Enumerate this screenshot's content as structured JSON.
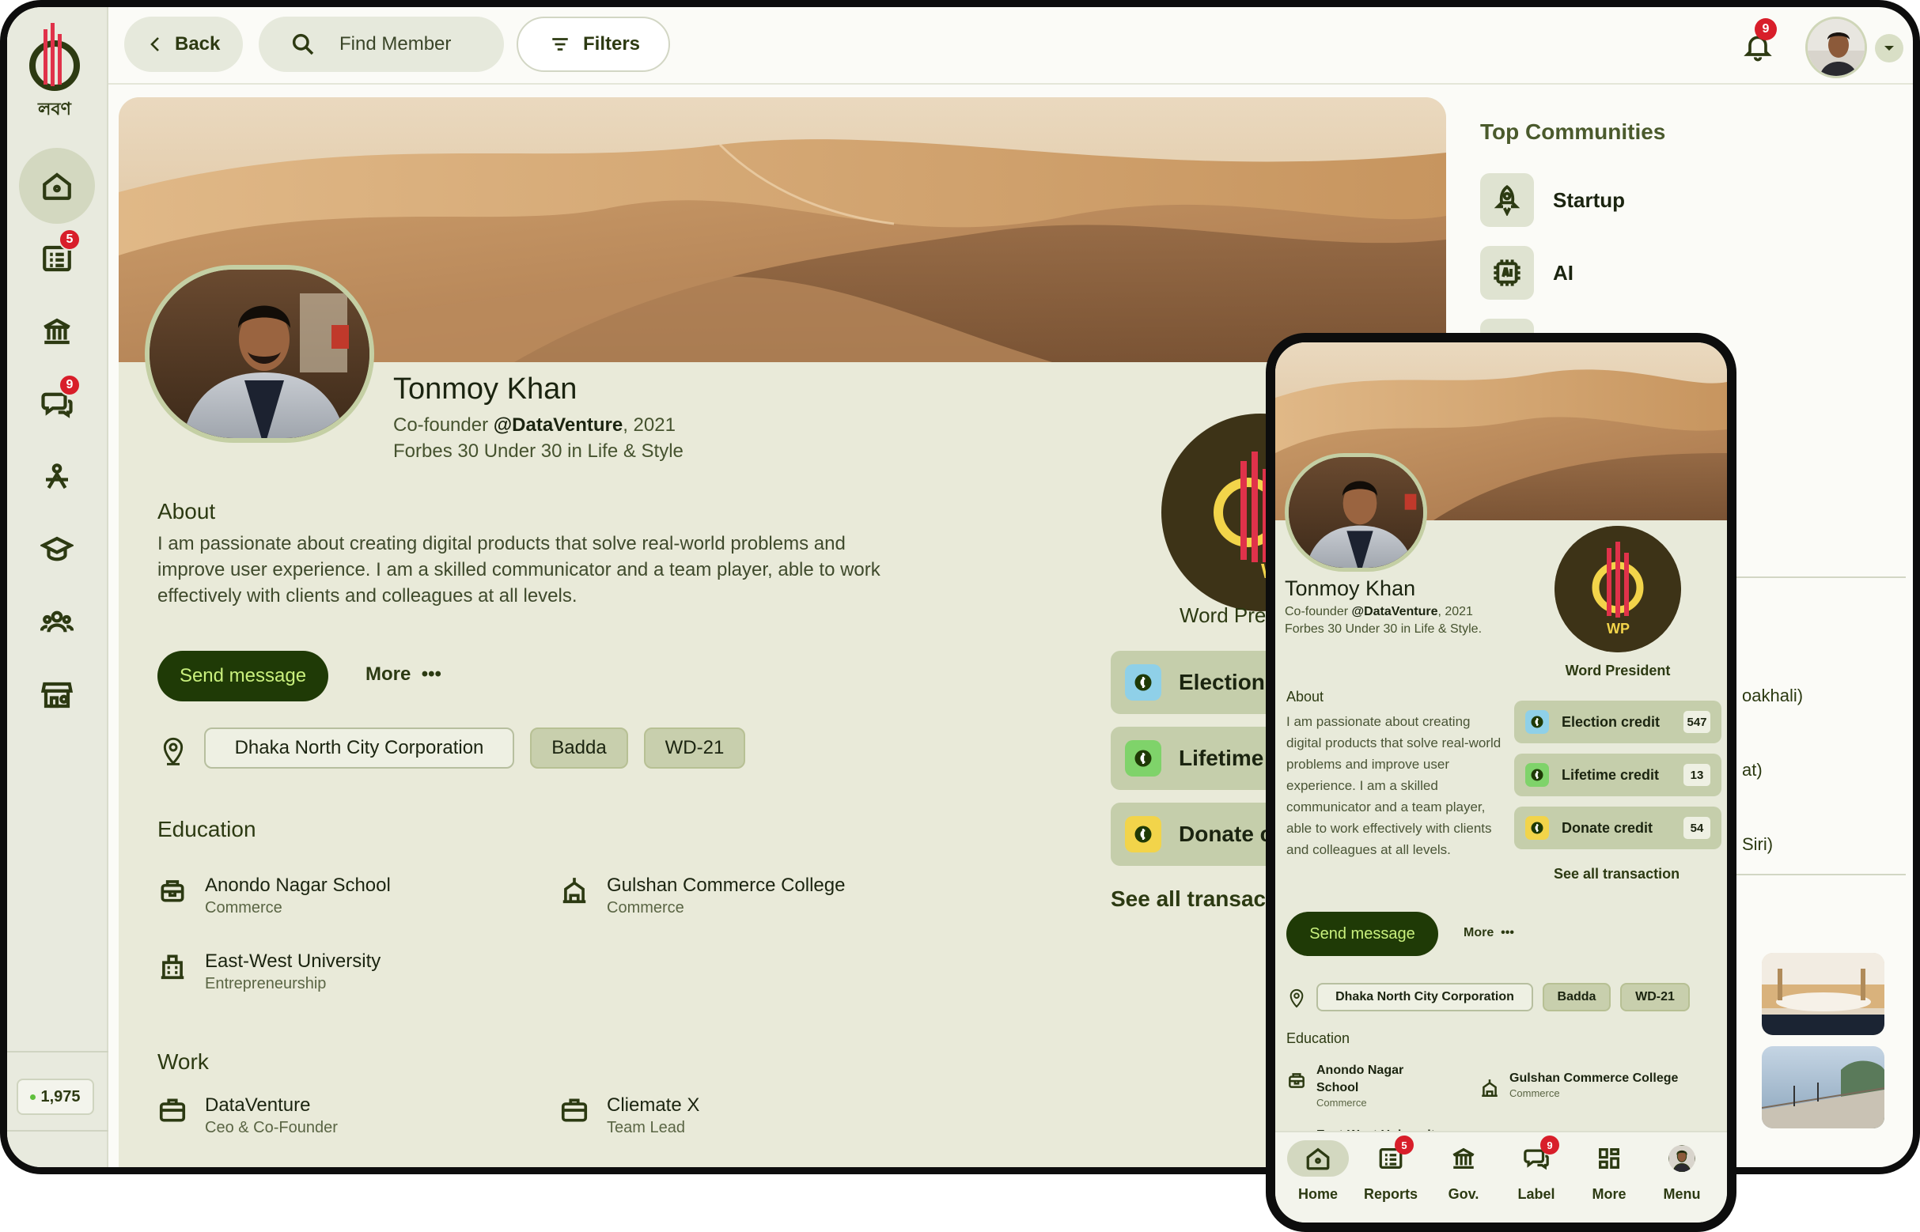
{
  "app": {
    "logo_text": "লবণ",
    "points": "1,975"
  },
  "sidebar": {
    "items": [
      {
        "icon": "home-icon"
      },
      {
        "icon": "reports-icon",
        "badge": "5"
      },
      {
        "icon": "government-icon"
      },
      {
        "icon": "chat-icon",
        "badge": "9"
      },
      {
        "icon": "community-icon"
      },
      {
        "icon": "education-icon"
      },
      {
        "icon": "people-icon"
      },
      {
        "icon": "store-icon"
      }
    ]
  },
  "topbar": {
    "back_label": "Back",
    "find_label": "Find Member",
    "filters_label": "Filters",
    "notifications_badge": "9"
  },
  "profile": {
    "name": "Tonmoy Khan",
    "role_prefix": "Co-founder ",
    "company": "@DataVenture",
    "role_suffix": ", 2021",
    "honor": "Forbes 30 Under 30 in Life & Style",
    "about_title": "About",
    "about_text": "I am passionate about creating digital products that solve real-world problems and improve user experience. I am a skilled communicator and a team player, able to work effectively with clients and colleagues at all levels.",
    "send_message": "Send message",
    "more": "More",
    "more_icon": "•••",
    "location": [
      "Dhaka North City Corporation",
      "Badda",
      "WD-21"
    ],
    "education_title": "Education",
    "education": [
      {
        "name": "Anondo Nagar School",
        "sub": "Commerce",
        "icon": "school-icon"
      },
      {
        "name": "Gulshan Commerce College",
        "sub": "Commerce",
        "icon": "college-icon"
      },
      {
        "name": "East-West University",
        "sub": "Entrepreneurship",
        "icon": "university-icon"
      }
    ],
    "work_title": "Work",
    "work": [
      {
        "name": "DataVenture",
        "sub": "Ceo & Co-Founder",
        "icon": "briefcase-icon"
      },
      {
        "name": "Cliemate X",
        "sub": "Team Lead",
        "icon": "briefcase-icon"
      }
    ],
    "badge_label": "Word Pre",
    "badge_initials": "WF",
    "credits_desktop": [
      "Election",
      "Lifetime",
      "Donate cr"
    ],
    "see_all_desktop": "See all transacti"
  },
  "communities": {
    "title": "Top Communities",
    "items": [
      {
        "label": "Startup",
        "icon": "rocket-icon"
      },
      {
        "label": "AI",
        "icon": "ai-chip-icon"
      }
    ],
    "fragments": [
      "oakhali)",
      "at)",
      "Siri)"
    ]
  },
  "phone": {
    "name": "Tonmoy Khan",
    "sub_prefix": "Co-founder ",
    "sub_company": "@DataVenture",
    "sub_rest": ", 2021 Forbes 30 Under 30 in Life & Style.",
    "wp_initials": "WP",
    "wp_label": "Word President",
    "about_title": "About",
    "about_text": "I am passionate about creating digital products that solve real-world problems and improve user experience. I am a skilled communicator and a team player, able to work effectively with clients and colleagues at all levels.",
    "credits": [
      {
        "label": "Election credit",
        "count": "547",
        "color": "#8fd0e8"
      },
      {
        "label": "Lifetime credit",
        "count": "13",
        "color": "#7fd36a"
      },
      {
        "label": "Donate credit",
        "count": "54",
        "color": "#f2d44a"
      }
    ],
    "see_all": "See all transaction",
    "send_message": "Send message",
    "more": "More",
    "more_icon": "•••",
    "location": [
      "Dhaka North City Corporation",
      "Badda",
      "WD-21"
    ],
    "education_title": "Education",
    "education": [
      {
        "name": "Anondo Nagar School",
        "sub": "Commerce"
      },
      {
        "name": "Gulshan Commerce College",
        "sub": "Commerce"
      },
      {
        "name": "East-West University",
        "sub": ""
      }
    ],
    "tabs": [
      {
        "label": "Home",
        "icon": "home-icon"
      },
      {
        "label": "Reports",
        "icon": "reports-icon",
        "badge": "5"
      },
      {
        "label": "Gov.",
        "icon": "government-icon"
      },
      {
        "label": "Label",
        "icon": "chat-icon",
        "badge": "9"
      },
      {
        "label": "More",
        "icon": "grid-icon"
      },
      {
        "label": "Menu",
        "icon": "avatar"
      }
    ]
  },
  "colors": {
    "primary_dark": "#1f3a06",
    "accent_text": "#c9f07d",
    "badge_red": "#d81e2a",
    "surface": "#e9ead9"
  }
}
